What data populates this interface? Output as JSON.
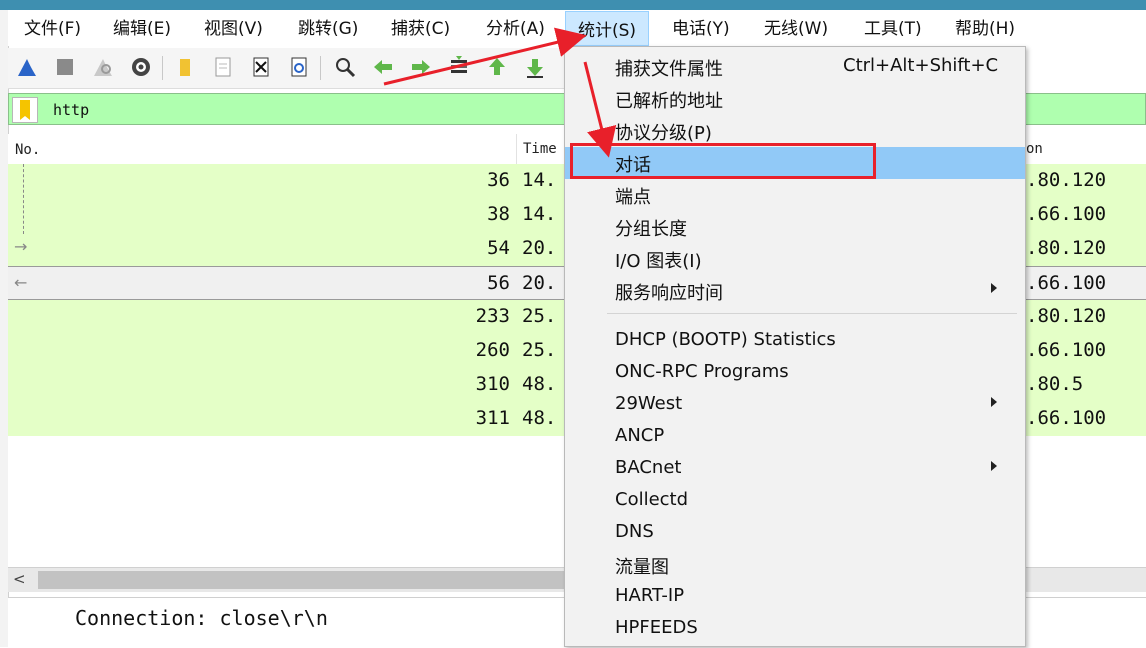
{
  "menubar": {
    "items": [
      {
        "label": "文件(F)"
      },
      {
        "label": "编辑(E)"
      },
      {
        "label": "视图(V)"
      },
      {
        "label": "跳转(G)"
      },
      {
        "label": "捕获(C)"
      },
      {
        "label": "分析(A)"
      },
      {
        "label": "统计(S)"
      },
      {
        "label": "电话(Y)"
      },
      {
        "label": "无线(W)"
      },
      {
        "label": "工具(T)"
      },
      {
        "label": "帮助(H)"
      }
    ]
  },
  "filter": {
    "value": "http"
  },
  "packet_list": {
    "headers": {
      "no": "No.",
      "time": "Time",
      "destination": "on"
    },
    "rows": [
      {
        "no": "36",
        "time": "14.",
        "destination": ".80.120"
      },
      {
        "no": "38",
        "time": "14.",
        "destination": ".66.100"
      },
      {
        "no": "54",
        "time": "20.",
        "destination": ".80.120"
      },
      {
        "no": "56",
        "time": "20.",
        "destination": ".66.100",
        "selected": true
      },
      {
        "no": "233",
        "time": "25.",
        "destination": ".80.120"
      },
      {
        "no": "260",
        "time": "25.",
        "destination": ".66.100"
      },
      {
        "no": "310",
        "time": "48.",
        "destination": ".80.5"
      },
      {
        "no": "311",
        "time": "48.",
        "destination": ".66.100"
      }
    ]
  },
  "details": {
    "line1": "Connection: close\\r\\n"
  },
  "stats_menu": {
    "items": [
      {
        "label": "捕获文件属性",
        "shortcut": "Ctrl+Alt+Shift+C"
      },
      {
        "label": "已解析的地址"
      },
      {
        "label": "协议分级(P)"
      },
      {
        "label": "对话",
        "highlighted": true
      },
      {
        "label": "端点"
      },
      {
        "label": "分组长度"
      },
      {
        "label": "I/O 图表(I)"
      },
      {
        "label": "服务响应时间",
        "submenu": true
      },
      {
        "label": "DHCP (BOOTP) Statistics"
      },
      {
        "label": "ONC-RPC Programs"
      },
      {
        "label": "29West",
        "submenu": true
      },
      {
        "label": "ANCP"
      },
      {
        "label": "BACnet",
        "submenu": true
      },
      {
        "label": "Collectd"
      },
      {
        "label": "DNS"
      },
      {
        "label": "流量图"
      },
      {
        "label": "HART-IP"
      },
      {
        "label": "HPFEEDS"
      }
    ]
  },
  "colors": {
    "filter_bg": "#afffaf",
    "row_bg": "#e4ffc7",
    "menu_highlight": "#91c9f7",
    "annotation_red": "#e8202a"
  },
  "icons": [
    "shark-fin-start-icon",
    "stop-icon",
    "restart-icon",
    "options-gear-icon",
    "open-folder-icon",
    "save-file-icon",
    "close-file-icon",
    "reload-icon",
    "find-icon",
    "back-arrow-icon",
    "forward-arrow-icon",
    "go-to-packet-icon",
    "first-packet-icon",
    "last-packet-icon",
    "bookmark-icon"
  ]
}
